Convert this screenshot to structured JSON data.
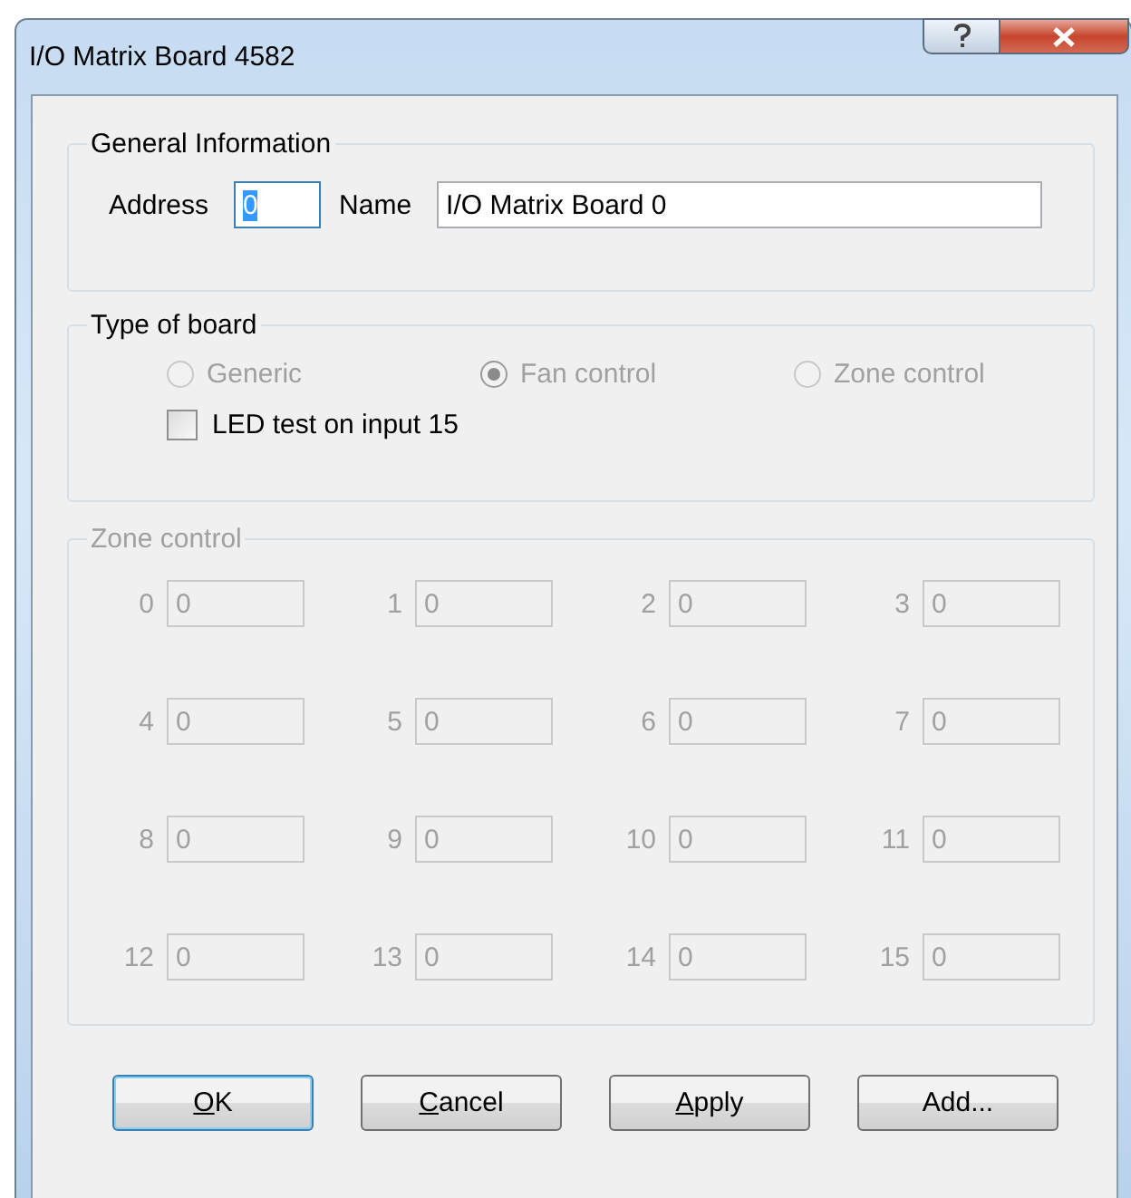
{
  "window": {
    "title": "I/O Matrix Board 4582"
  },
  "general": {
    "title": "General Information",
    "address": {
      "label": "Address",
      "value": "0",
      "focused": true
    },
    "name": {
      "label": "Name",
      "value": "I/O Matrix Board 0",
      "focused": false
    }
  },
  "board_type": {
    "title": "Type of board",
    "options": [
      {
        "label": "Generic",
        "selected": false,
        "disabled": true
      },
      {
        "label": "Fan control",
        "selected": true,
        "disabled": true
      },
      {
        "label": "Zone control",
        "selected": false,
        "disabled": true
      }
    ],
    "led_test": {
      "label": "LED test on input 15",
      "checked": false,
      "disabled": false
    }
  },
  "zone_control": {
    "title": "Zone control",
    "disabled": true,
    "zones": [
      {
        "label": "0",
        "value": "0"
      },
      {
        "label": "1",
        "value": "0"
      },
      {
        "label": "2",
        "value": "0"
      },
      {
        "label": "3",
        "value": "0"
      },
      {
        "label": "4",
        "value": "0"
      },
      {
        "label": "5",
        "value": "0"
      },
      {
        "label": "6",
        "value": "0"
      },
      {
        "label": "7",
        "value": "0"
      },
      {
        "label": "8",
        "value": "0"
      },
      {
        "label": "9",
        "value": "0"
      },
      {
        "label": "10",
        "value": "0"
      },
      {
        "label": "11",
        "value": "0"
      },
      {
        "label": "12",
        "value": "0"
      },
      {
        "label": "13",
        "value": "0"
      },
      {
        "label": "14",
        "value": "0"
      },
      {
        "label": "15",
        "value": "0"
      }
    ]
  },
  "buttons": [
    {
      "mnemonic": "O",
      "rest": "K",
      "default": true
    },
    {
      "mnemonic": "C",
      "rest": "ancel",
      "default": false
    },
    {
      "mnemonic": "A",
      "rest": "pply",
      "default": false
    },
    {
      "rest": "Add...",
      "default": false
    }
  ]
}
